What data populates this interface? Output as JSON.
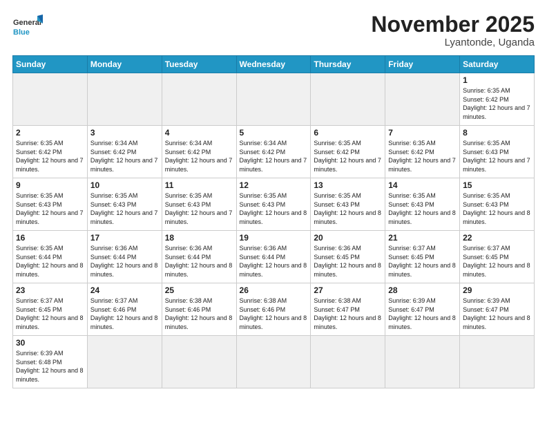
{
  "logo": {
    "general": "General",
    "blue": "Blue"
  },
  "title": "November 2025",
  "location": "Lyantonde, Uganda",
  "days_of_week": [
    "Sunday",
    "Monday",
    "Tuesday",
    "Wednesday",
    "Thursday",
    "Friday",
    "Saturday"
  ],
  "weeks": [
    [
      {
        "day": "",
        "info": "",
        "empty": true
      },
      {
        "day": "",
        "info": "",
        "empty": true
      },
      {
        "day": "",
        "info": "",
        "empty": true
      },
      {
        "day": "",
        "info": "",
        "empty": true
      },
      {
        "day": "",
        "info": "",
        "empty": true
      },
      {
        "day": "",
        "info": "",
        "empty": true
      },
      {
        "day": "1",
        "info": "Sunrise: 6:35 AM\nSunset: 6:42 PM\nDaylight: 12 hours\nand 7 minutes.",
        "empty": false
      }
    ],
    [
      {
        "day": "2",
        "info": "Sunrise: 6:35 AM\nSunset: 6:42 PM\nDaylight: 12 hours\nand 7 minutes.",
        "empty": false
      },
      {
        "day": "3",
        "info": "Sunrise: 6:34 AM\nSunset: 6:42 PM\nDaylight: 12 hours\nand 7 minutes.",
        "empty": false
      },
      {
        "day": "4",
        "info": "Sunrise: 6:34 AM\nSunset: 6:42 PM\nDaylight: 12 hours\nand 7 minutes.",
        "empty": false
      },
      {
        "day": "5",
        "info": "Sunrise: 6:34 AM\nSunset: 6:42 PM\nDaylight: 12 hours\nand 7 minutes.",
        "empty": false
      },
      {
        "day": "6",
        "info": "Sunrise: 6:35 AM\nSunset: 6:42 PM\nDaylight: 12 hours\nand 7 minutes.",
        "empty": false
      },
      {
        "day": "7",
        "info": "Sunrise: 6:35 AM\nSunset: 6:42 PM\nDaylight: 12 hours\nand 7 minutes.",
        "empty": false
      },
      {
        "day": "8",
        "info": "Sunrise: 6:35 AM\nSunset: 6:43 PM\nDaylight: 12 hours\nand 7 minutes.",
        "empty": false
      }
    ],
    [
      {
        "day": "9",
        "info": "Sunrise: 6:35 AM\nSunset: 6:43 PM\nDaylight: 12 hours\nand 7 minutes.",
        "empty": false
      },
      {
        "day": "10",
        "info": "Sunrise: 6:35 AM\nSunset: 6:43 PM\nDaylight: 12 hours\nand 7 minutes.",
        "empty": false
      },
      {
        "day": "11",
        "info": "Sunrise: 6:35 AM\nSunset: 6:43 PM\nDaylight: 12 hours\nand 7 minutes.",
        "empty": false
      },
      {
        "day": "12",
        "info": "Sunrise: 6:35 AM\nSunset: 6:43 PM\nDaylight: 12 hours\nand 8 minutes.",
        "empty": false
      },
      {
        "day": "13",
        "info": "Sunrise: 6:35 AM\nSunset: 6:43 PM\nDaylight: 12 hours\nand 8 minutes.",
        "empty": false
      },
      {
        "day": "14",
        "info": "Sunrise: 6:35 AM\nSunset: 6:43 PM\nDaylight: 12 hours\nand 8 minutes.",
        "empty": false
      },
      {
        "day": "15",
        "info": "Sunrise: 6:35 AM\nSunset: 6:43 PM\nDaylight: 12 hours\nand 8 minutes.",
        "empty": false
      }
    ],
    [
      {
        "day": "16",
        "info": "Sunrise: 6:35 AM\nSunset: 6:44 PM\nDaylight: 12 hours\nand 8 minutes.",
        "empty": false
      },
      {
        "day": "17",
        "info": "Sunrise: 6:36 AM\nSunset: 6:44 PM\nDaylight: 12 hours\nand 8 minutes.",
        "empty": false
      },
      {
        "day": "18",
        "info": "Sunrise: 6:36 AM\nSunset: 6:44 PM\nDaylight: 12 hours\nand 8 minutes.",
        "empty": false
      },
      {
        "day": "19",
        "info": "Sunrise: 6:36 AM\nSunset: 6:44 PM\nDaylight: 12 hours\nand 8 minutes.",
        "empty": false
      },
      {
        "day": "20",
        "info": "Sunrise: 6:36 AM\nSunset: 6:45 PM\nDaylight: 12 hours\nand 8 minutes.",
        "empty": false
      },
      {
        "day": "21",
        "info": "Sunrise: 6:37 AM\nSunset: 6:45 PM\nDaylight: 12 hours\nand 8 minutes.",
        "empty": false
      },
      {
        "day": "22",
        "info": "Sunrise: 6:37 AM\nSunset: 6:45 PM\nDaylight: 12 hours\nand 8 minutes.",
        "empty": false
      }
    ],
    [
      {
        "day": "23",
        "info": "Sunrise: 6:37 AM\nSunset: 6:45 PM\nDaylight: 12 hours\nand 8 minutes.",
        "empty": false
      },
      {
        "day": "24",
        "info": "Sunrise: 6:37 AM\nSunset: 6:46 PM\nDaylight: 12 hours\nand 8 minutes.",
        "empty": false
      },
      {
        "day": "25",
        "info": "Sunrise: 6:38 AM\nSunset: 6:46 PM\nDaylight: 12 hours\nand 8 minutes.",
        "empty": false
      },
      {
        "day": "26",
        "info": "Sunrise: 6:38 AM\nSunset: 6:46 PM\nDaylight: 12 hours\nand 8 minutes.",
        "empty": false
      },
      {
        "day": "27",
        "info": "Sunrise: 6:38 AM\nSunset: 6:47 PM\nDaylight: 12 hours\nand 8 minutes.",
        "empty": false
      },
      {
        "day": "28",
        "info": "Sunrise: 6:39 AM\nSunset: 6:47 PM\nDaylight: 12 hours\nand 8 minutes.",
        "empty": false
      },
      {
        "day": "29",
        "info": "Sunrise: 6:39 AM\nSunset: 6:47 PM\nDaylight: 12 hours\nand 8 minutes.",
        "empty": false
      }
    ],
    [
      {
        "day": "30",
        "info": "Sunrise: 6:39 AM\nSunset: 6:48 PM\nDaylight: 12 hours\nand 8 minutes.",
        "empty": false
      },
      {
        "day": "",
        "info": "",
        "empty": true
      },
      {
        "day": "",
        "info": "",
        "empty": true
      },
      {
        "day": "",
        "info": "",
        "empty": true
      },
      {
        "day": "",
        "info": "",
        "empty": true
      },
      {
        "day": "",
        "info": "",
        "empty": true
      },
      {
        "day": "",
        "info": "",
        "empty": true
      }
    ]
  ]
}
